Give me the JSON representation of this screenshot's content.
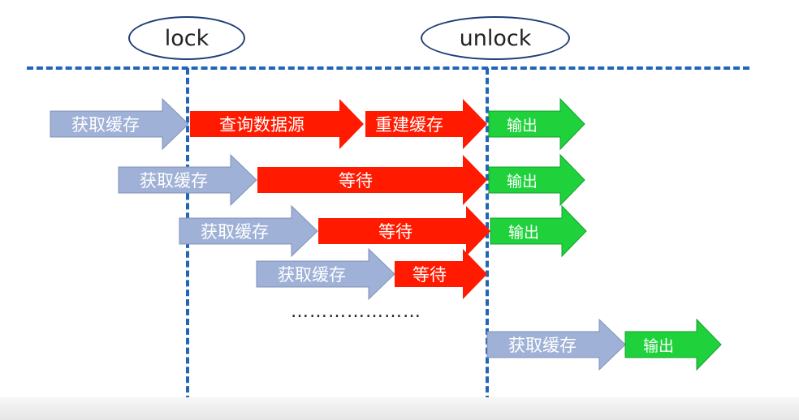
{
  "markers": {
    "lock": "lock",
    "unlock": "unlock"
  },
  "rows": [
    {
      "arrows": [
        {
          "text": "获取缓存",
          "kind": "fetch"
        },
        {
          "text": "查询数据源",
          "kind": "process"
        },
        {
          "text": "重建缓存",
          "kind": "process"
        },
        {
          "text": "输出",
          "kind": "output"
        }
      ]
    },
    {
      "arrows": [
        {
          "text": "获取缓存",
          "kind": "fetch"
        },
        {
          "text": "等待",
          "kind": "process"
        },
        {
          "text": "输出",
          "kind": "output"
        }
      ]
    },
    {
      "arrows": [
        {
          "text": "获取缓存",
          "kind": "fetch"
        },
        {
          "text": "等待",
          "kind": "process"
        },
        {
          "text": "输出",
          "kind": "output"
        }
      ]
    },
    {
      "arrows": [
        {
          "text": "获取缓存",
          "kind": "fetch"
        },
        {
          "text": "等待",
          "kind": "process"
        }
      ]
    },
    {
      "arrows": [
        {
          "text": "获取缓存",
          "kind": "fetch"
        },
        {
          "text": "输出",
          "kind": "output"
        }
      ]
    }
  ],
  "ellipsis": "…………………",
  "colors": {
    "fetch": "#9fb1d6",
    "process": "#ff1a00",
    "output": "#1fd23c",
    "dashed_line": "#1f65b8",
    "ellipse_border": "#1f3e78"
  }
}
